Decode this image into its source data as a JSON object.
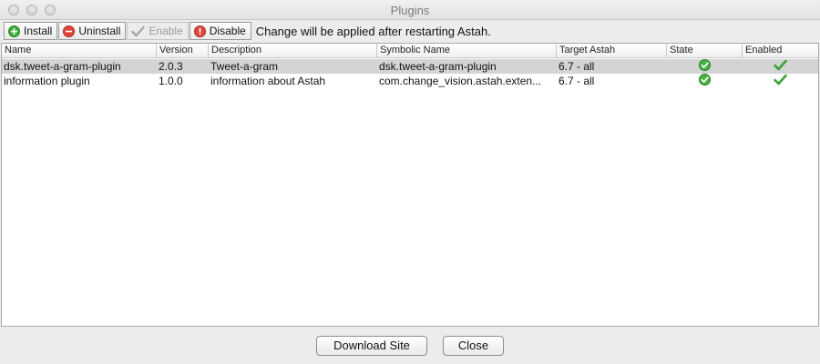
{
  "window": {
    "title": "Plugins"
  },
  "toolbar": {
    "install_label": "Install",
    "uninstall_label": "Uninstall",
    "enable_label": "Enable",
    "disable_label": "Disable",
    "notice": "Change will be applied after restarting Astah."
  },
  "table": {
    "columns": [
      "Name",
      "Version",
      "Description",
      "Symbolic Name",
      "Target Astah",
      "State",
      "Enabled"
    ],
    "rows": [
      {
        "name": "dsk.tweet-a-gram-plugin",
        "version": "2.0.3",
        "description": "Tweet-a-gram",
        "symbolic_name": "dsk.tweet-a-gram-plugin",
        "target": "6.7 - all",
        "state_icon": "green-check-circle-icon",
        "enabled_icon": "green-checkmark-icon",
        "selected": true
      },
      {
        "name": "information plugin",
        "version": "1.0.0",
        "description": "information about Astah",
        "symbolic_name": "com.change_vision.astah.exten...",
        "target": "6.7 - all",
        "state_icon": "green-check-circle-icon",
        "enabled_icon": "green-checkmark-icon",
        "selected": false
      }
    ]
  },
  "footer": {
    "download_label": "Download Site",
    "close_label": "Close"
  },
  "colors": {
    "selected_row": "#d4d4d4",
    "check_green": "#3aa335"
  }
}
